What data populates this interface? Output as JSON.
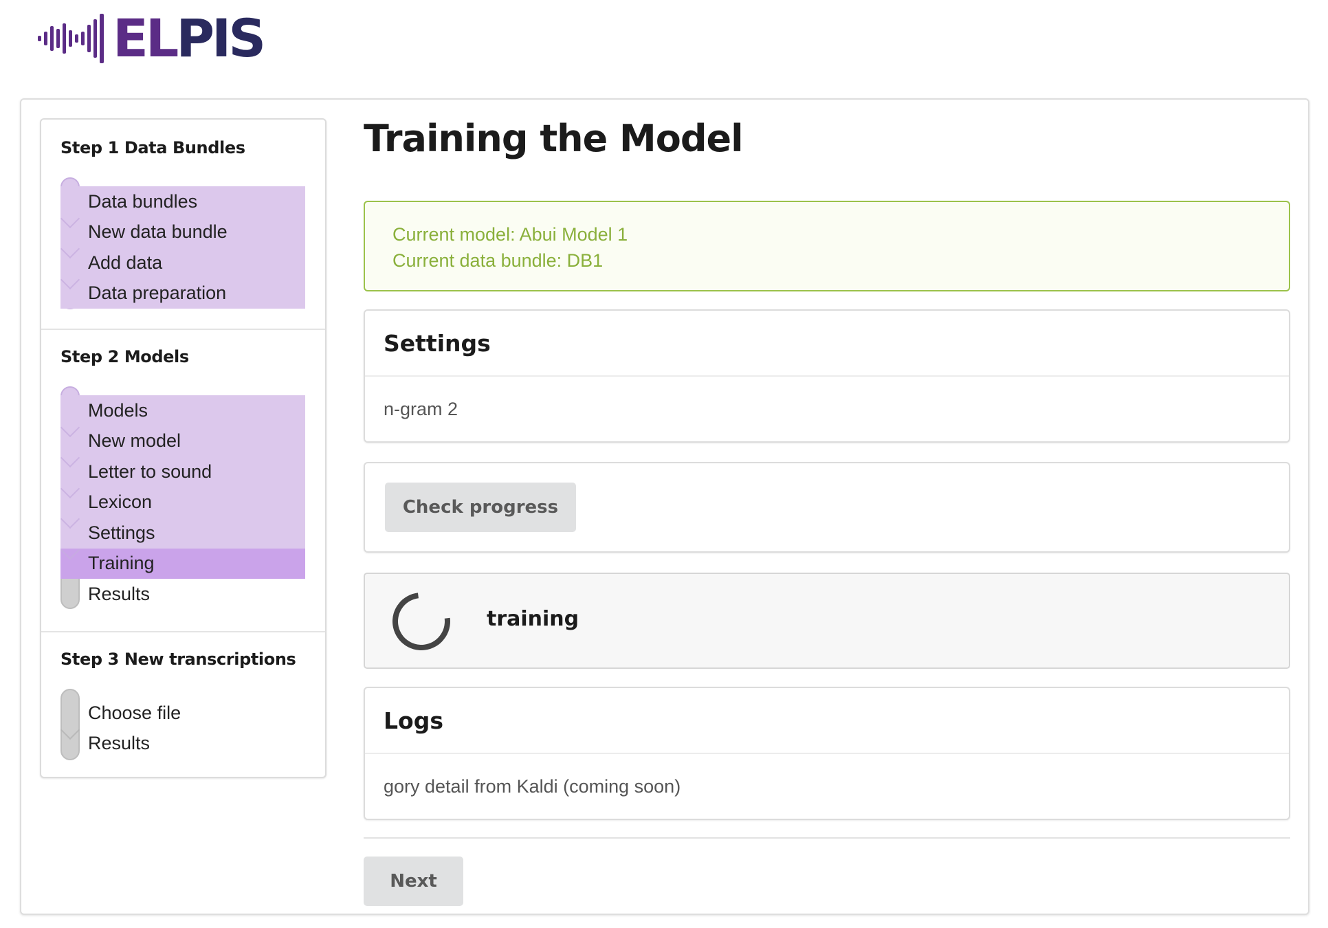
{
  "app": {
    "logo_text": "ELPIS"
  },
  "sidebar": {
    "steps": [
      {
        "title": "Step 1 Data Bundles",
        "items": [
          "Data bundles",
          "New data bundle",
          "Add data",
          "Data preparation"
        ]
      },
      {
        "title": "Step 2 Models",
        "items": [
          "Models",
          "New model",
          "Letter to sound",
          "Lexicon",
          "Settings",
          "Training",
          "Results"
        ],
        "active_item": "Training"
      },
      {
        "title": "Step 3 New transcriptions",
        "items": [
          "Choose file",
          "Results"
        ]
      }
    ]
  },
  "main": {
    "title": "Training the Model",
    "info": {
      "current_model": "Current model: Abui Model 1",
      "current_bundle": "Current data bundle: DB1"
    },
    "settings": {
      "heading": "Settings",
      "value": "n-gram 2"
    },
    "check_progress_label": "Check progress",
    "status": {
      "text": "training"
    },
    "logs": {
      "heading": "Logs",
      "text": "gory detail from Kaldi (coming soon)"
    },
    "next_label": "Next"
  },
  "colors": {
    "brand_purple": "#5b2c86",
    "brand_navy": "#2a2a5e",
    "step_done": "#dcc8ec",
    "step_active": "#caa3ea",
    "info_border": "#9bc24a",
    "info_text": "#8ab03b"
  }
}
